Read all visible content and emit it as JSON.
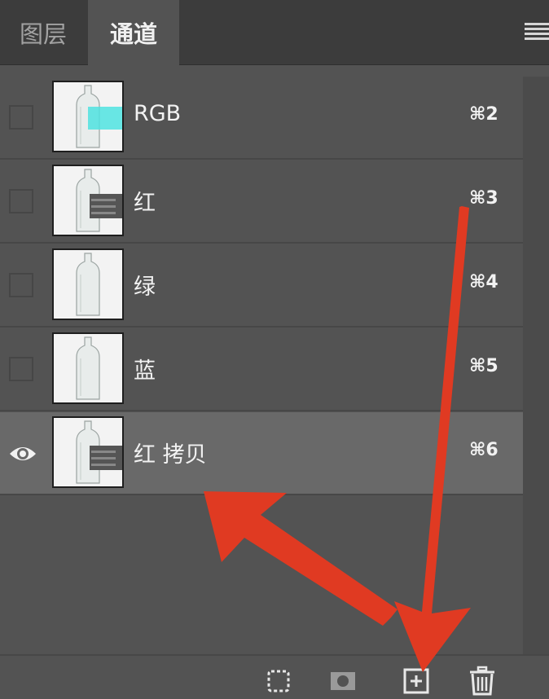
{
  "tabs": [
    {
      "label": "图层",
      "active": false
    },
    {
      "label": "通道",
      "active": true
    }
  ],
  "channels": [
    {
      "name": "RGB",
      "shortcut": "⌘2",
      "visible": false,
      "selected": false,
      "thumb": "rgb"
    },
    {
      "name": "红",
      "shortcut": "⌘3",
      "visible": false,
      "selected": false,
      "thumb": "red"
    },
    {
      "name": "绿",
      "shortcut": "⌘4",
      "visible": false,
      "selected": false,
      "thumb": "plain"
    },
    {
      "name": "蓝",
      "shortcut": "⌘5",
      "visible": false,
      "selected": false,
      "thumb": "plain"
    },
    {
      "name": "红 拷贝",
      "shortcut": "⌘6",
      "visible": true,
      "selected": true,
      "thumb": "red"
    }
  ],
  "toolbar": {
    "buttons": [
      {
        "icon": "load-selection-icon"
      },
      {
        "icon": "save-selection-icon"
      },
      {
        "icon": "new-channel-icon"
      },
      {
        "icon": "trash-icon"
      }
    ]
  },
  "colors": {
    "panel": "#535353",
    "tabbar": "#3c3c3c",
    "selected_row": "#696969",
    "annotation_arrow": "#e03a22",
    "rgb_overlay": "#4fe3e0"
  }
}
